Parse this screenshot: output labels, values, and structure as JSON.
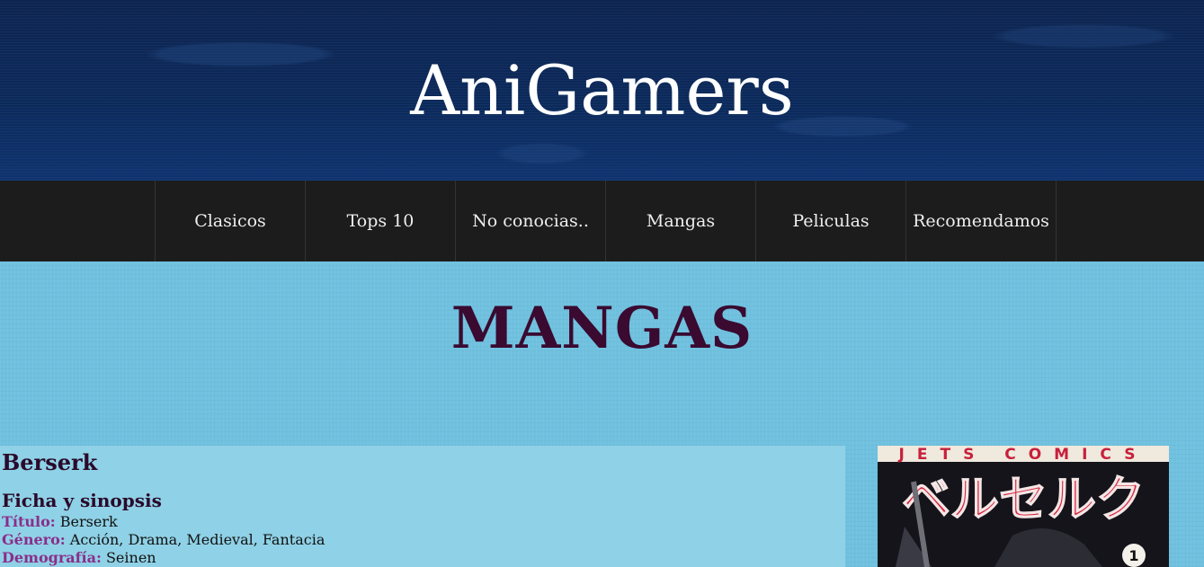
{
  "header": {
    "site_title": "AniGamers"
  },
  "nav": {
    "items": [
      {
        "label": "Clasicos"
      },
      {
        "label": "Tops 10"
      },
      {
        "label": "No conocias.."
      },
      {
        "label": "Mangas"
      },
      {
        "label": "Peliculas"
      },
      {
        "label": "Recomendamos"
      }
    ]
  },
  "main": {
    "heading": "MANGAS",
    "article": {
      "title": "Berserk",
      "section_title": "Ficha y sinopsis",
      "fields": [
        {
          "label": "Título:",
          "value": "Berserk"
        },
        {
          "label": "Género:",
          "value": "Acción, Drama, Medieval, Fantacia"
        },
        {
          "label": "Demografía:",
          "value": "Seinen"
        }
      ],
      "cover": {
        "publisher_text": "JETS COMICS",
        "title_text": "ベルセルク",
        "volume": "1"
      }
    }
  },
  "colors": {
    "header_bg": "#0d2450",
    "nav_bg": "#1c1c1c",
    "main_bg": "#6fc1df",
    "heading": "#3a0a30",
    "field_label": "#8a2e8a"
  }
}
